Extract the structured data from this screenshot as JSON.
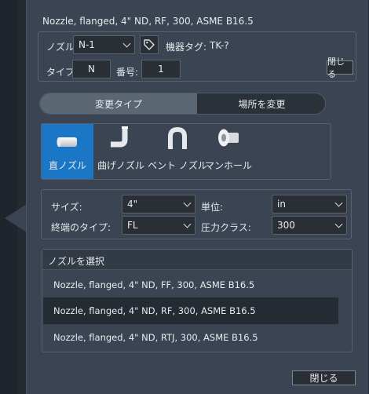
{
  "title": "Nozzle, flanged, 4\" ND, RF, 300, ASME B16.5",
  "nozzle": {
    "label": "ノズル:",
    "value": "N-1",
    "tag_label": "機器タグ:",
    "tag_value": "TK-?",
    "type_label": "タイプ:",
    "type_value": "N",
    "number_label": "番号:",
    "number_value": "1",
    "close_label": "閉じる"
  },
  "segment": {
    "left": "変更タイプ",
    "right": "場所を変更",
    "selected": "変更タイプ"
  },
  "types": [
    {
      "label": "直ノズル",
      "icon": "straight-nozzle-icon",
      "selected": true
    },
    {
      "label": "曲げノズル",
      "icon": "bent-nozzle-icon",
      "selected": false
    },
    {
      "label": "ベント ノズル",
      "icon": "vent-nozzle-icon",
      "selected": false
    },
    {
      "label": "マンホール",
      "icon": "manhole-icon",
      "selected": false
    }
  ],
  "props": {
    "size_label": "サイズ:",
    "size_value": "4\"",
    "unit_label": "単位:",
    "unit_value": "in",
    "end_label": "終端のタイプ:",
    "end_value": "FL",
    "pressure_label": "圧力クラス:",
    "pressure_value": "300"
  },
  "select_list": {
    "header": "ノズルを選択",
    "items": [
      "Nozzle, flanged, 4\" ND, FF, 300, ASME B16.5",
      "Nozzle, flanged, 4\" ND, RF, 300, ASME B16.5",
      "Nozzle, flanged, 4\" ND, RTJ, 300, ASME B16.5"
    ],
    "selected": "Nozzle, flanged, 4\" ND, RF, 300, ASME B16.5"
  },
  "footer": {
    "close_label": "閉じる"
  },
  "colors": {
    "panel": "#3b4452",
    "selected_type": "#1b77c5",
    "selected_row": "#252b33",
    "field": "#2a2f35"
  }
}
